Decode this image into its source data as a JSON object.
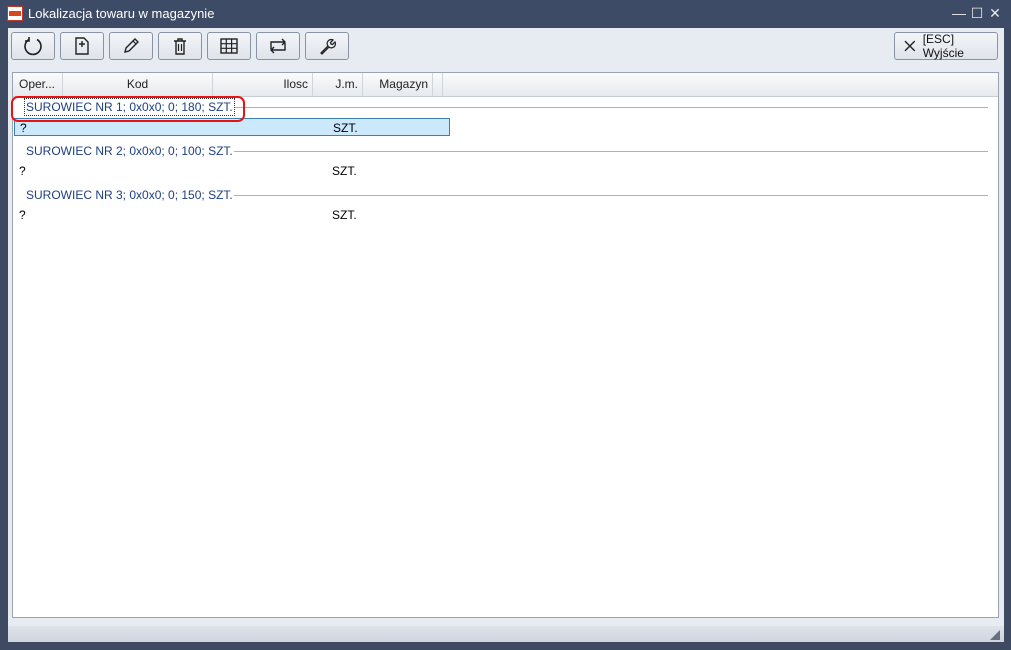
{
  "window": {
    "title": "Lokalizacja towaru w magazynie"
  },
  "title_controls": {
    "minimize": "—",
    "maximize": "☐",
    "close": "✕"
  },
  "toolbar": {
    "buttons": [
      {
        "name": "refresh-button",
        "icon": "refresh-icon"
      },
      {
        "name": "new-document-button",
        "icon": "new-document-icon"
      },
      {
        "name": "edit-button",
        "icon": "pencil-icon"
      },
      {
        "name": "delete-button",
        "icon": "trash-icon"
      },
      {
        "name": "grid-button",
        "icon": "grid-icon"
      },
      {
        "name": "swap-button",
        "icon": "swap-icon"
      },
      {
        "name": "settings-button",
        "icon": "wrench-icon"
      }
    ],
    "exit_label": "[ESC] Wyjście"
  },
  "grid": {
    "columns": [
      "Oper...",
      "Kod",
      "Ilosc",
      "J.m.",
      "Magazyn"
    ],
    "groups": [
      {
        "label": "SUROWIEC NR 1; 0x0x0; 0; 180; SZT.",
        "rows": [
          {
            "oper": "?",
            "jm": "SZT."
          }
        ]
      },
      {
        "label": "SUROWIEC NR 2; 0x0x0; 0; 100; SZT.",
        "rows": [
          {
            "oper": "?",
            "jm": "SZT."
          }
        ]
      },
      {
        "label": "SUROWIEC NR 3; 0x0x0; 0; 150; SZT.",
        "rows": [
          {
            "oper": "?",
            "jm": "SZT."
          }
        ]
      }
    ]
  },
  "colors": {
    "titlebar": "#3e4b66",
    "group_text": "#1e3f82",
    "selection": "#cce8fb",
    "highlight": "#e11111"
  }
}
